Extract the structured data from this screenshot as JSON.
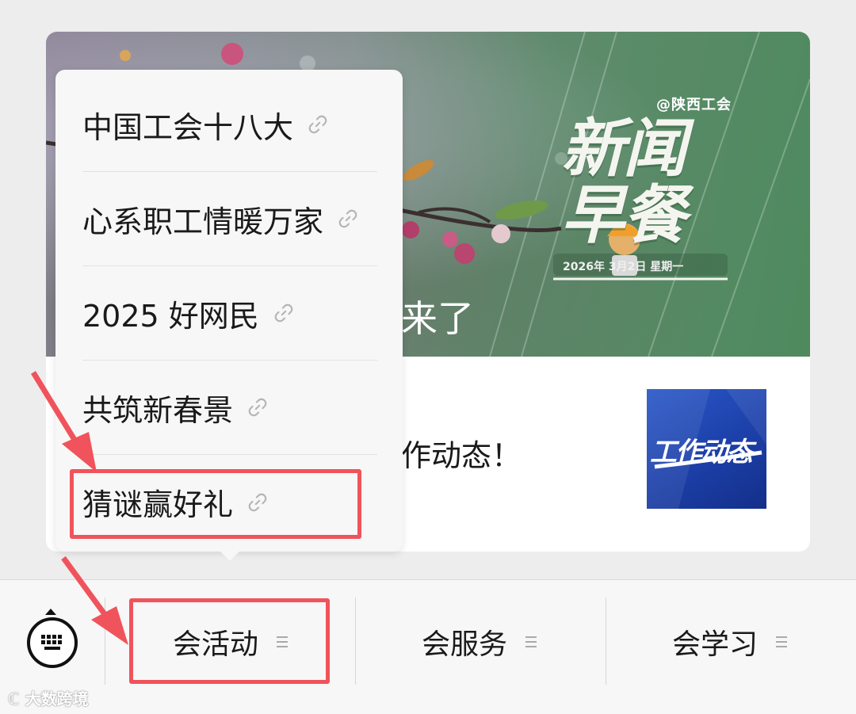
{
  "article": {
    "cover_handle": "@陕西工会",
    "cover_title_line1": "新闻",
    "cover_title_line2": "早餐",
    "cover_date": "2026年 3月2日 星期一",
    "headline_visible_tail": "来了",
    "second_headline_visible_tail": "作动态！",
    "thumbnail_text": "工作动态"
  },
  "popup_menu": {
    "items": [
      {
        "label": "中国工会十八大",
        "icon": "link-icon"
      },
      {
        "label": "心系职工情暖万家",
        "icon": "link-icon"
      },
      {
        "label": "2025 好网民",
        "icon": "link-icon"
      },
      {
        "label": "共筑新春景",
        "icon": "link-icon"
      },
      {
        "label": "猜谜赢好礼",
        "icon": "link-icon",
        "highlighted": true
      }
    ]
  },
  "bottom_menu": {
    "keyboard_icon": "keyboard-icon",
    "tabs": [
      {
        "label": "会活动",
        "icon": "menu-lines-icon",
        "highlighted": true
      },
      {
        "label": "会服务",
        "icon": "menu-lines-icon"
      },
      {
        "label": "会学习",
        "icon": "menu-lines-icon"
      }
    ]
  },
  "watermark": "大数跨境",
  "colors": {
    "highlight": "#f0535b",
    "background": "#ededed",
    "thumbnail_blue": "#1c3fa8",
    "cover_green": "#4e8a5e"
  }
}
